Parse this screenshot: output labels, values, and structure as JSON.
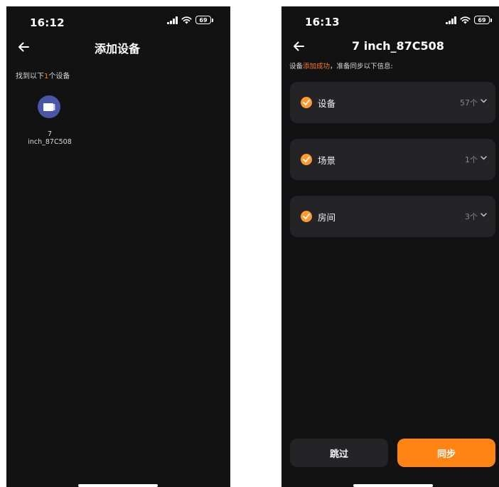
{
  "left_screen": {
    "status": {
      "time": "16:12",
      "battery": "69"
    },
    "title": "添加设备",
    "info_prefix": "找到以下",
    "info_count": "1",
    "info_suffix": "个设备",
    "device": {
      "name_line1": "7",
      "name_line2": "inch_87C508"
    }
  },
  "right_screen": {
    "status": {
      "time": "16:13",
      "battery": "69"
    },
    "title": "7 inch_87C508",
    "subtitle_prefix": "设备",
    "subtitle_highlight": "添加成功",
    "subtitle_suffix": "，准备同步以下信息:",
    "cards": [
      {
        "label": "设备",
        "count": "57个"
      },
      {
        "label": "场景",
        "count": "1个"
      },
      {
        "label": "房间",
        "count": "3个"
      }
    ],
    "skip_label": "跳过",
    "sync_label": "同步"
  },
  "colors": {
    "accent": "#ff8414",
    "check": "#ff9a2e",
    "background": "#121213",
    "card": "#242427",
    "device_avatar": "#4a56a6"
  },
  "icons": [
    "back-arrow-icon",
    "signal-icon",
    "wifi-icon",
    "battery-icon",
    "device-screen-icon",
    "checkmark-icon",
    "chevron-down-icon"
  ]
}
